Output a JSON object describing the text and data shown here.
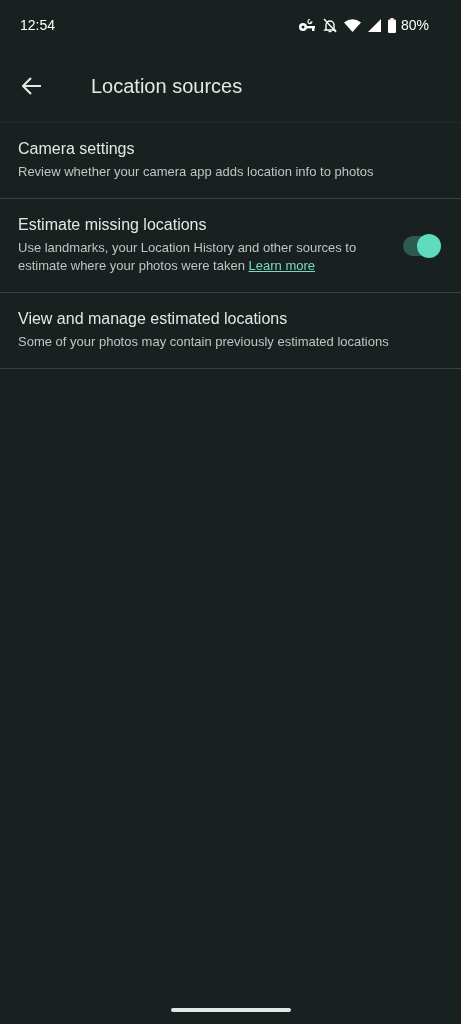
{
  "status_bar": {
    "time": "12:54",
    "battery": "80%"
  },
  "top_bar": {
    "title": "Location sources"
  },
  "items": [
    {
      "kind": "link",
      "title": "Camera settings",
      "summary": "Review whether your camera app adds location info to photos"
    },
    {
      "kind": "switch",
      "title": "Estimate missing locations",
      "summary": "Use landmarks, your Location History and other sources to estimate where your photos were taken",
      "link": "Learn more",
      "on": true
    },
    {
      "kind": "link",
      "title": "View and manage estimated locations",
      "summary": "Some of your photos may contain previously estimated locations"
    }
  ]
}
